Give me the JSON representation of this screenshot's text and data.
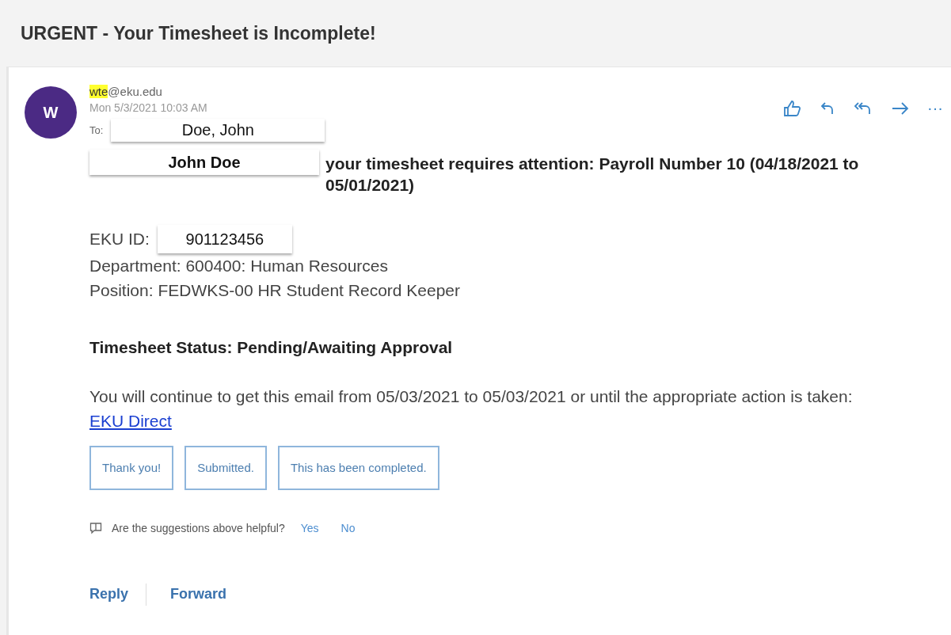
{
  "subject": "URGENT - Your Timesheet is Incomplete!",
  "sender": {
    "initial": "W",
    "highlighted": "wte",
    "rest": "@eku.edu",
    "date": "Mon 5/3/2021 10:03 AM"
  },
  "to": {
    "label": "To:",
    "name": "Doe, John"
  },
  "actions": [
    {
      "kind": "like"
    },
    {
      "kind": "reply"
    },
    {
      "kind": "reply-all"
    },
    {
      "kind": "forward"
    },
    {
      "kind": "more",
      "label": "···"
    }
  ],
  "greeting": {
    "name": "John Doe",
    "text": "your timesheet requires attention: Payroll Number 10 (04/18/2021 to 05/01/2021)"
  },
  "details": {
    "id_label": "EKU ID:",
    "id_value": "901123456",
    "department": "Department: 600400: Human Resources",
    "position": "Position: FEDWKS-00 HR Student Record Keeper"
  },
  "status": "Timesheet Status: Pending/Awaiting Approval",
  "notice": {
    "text": "You will continue to get this email from 05/03/2021 to 05/03/2021 or until the appropriate action is taken:",
    "link": "EKU Direct"
  },
  "suggestions": [
    "Thank you!",
    "Submitted.",
    "This has been completed."
  ],
  "feedback": {
    "question": "Are the suggestions above helpful?",
    "yes": "Yes",
    "no": "No"
  },
  "footer": [
    "Reply",
    "Forward"
  ]
}
